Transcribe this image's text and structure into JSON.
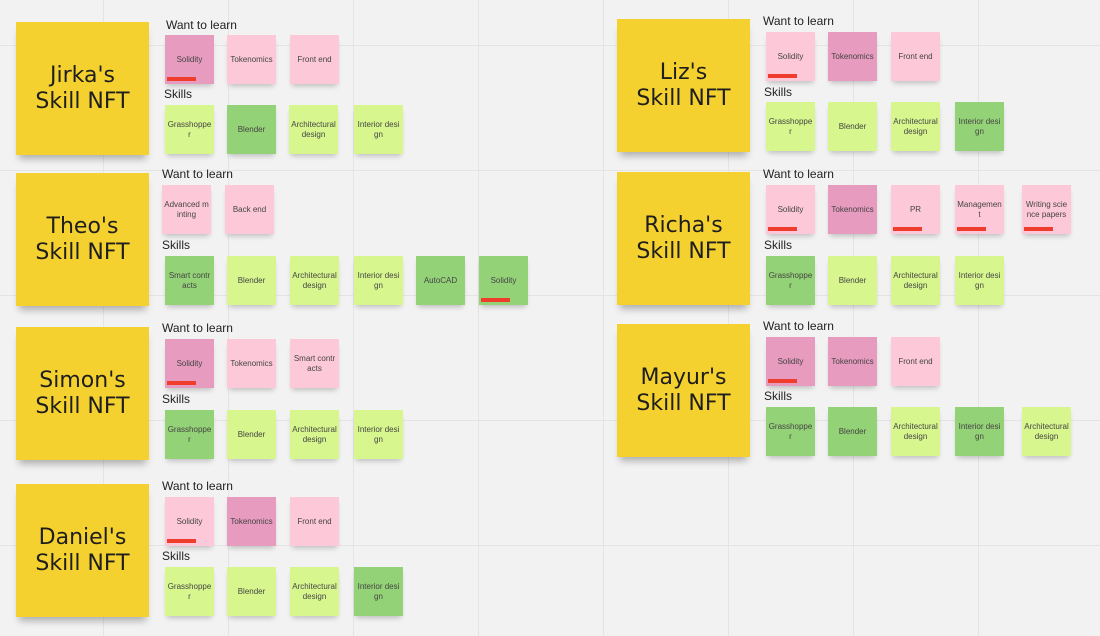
{
  "colors": {
    "title_note": "#f5d12f",
    "light_pink": "#fdc9d9",
    "dark_pink": "#e79bbf",
    "light_green": "#d7f78e",
    "dark_green": "#94d277",
    "marker": "#ee3d2c"
  },
  "labels": {
    "want": "Want to learn",
    "skills": "Skills"
  },
  "cards": [
    {
      "name": "Jirka's\nSkill NFT",
      "want": [
        {
          "text": "Solidity",
          "color": "dark-pink",
          "marked": true
        },
        {
          "text": "Tokenomics",
          "color": "light-pink",
          "marked": false
        },
        {
          "text": "Front end",
          "color": "light-pink",
          "marked": false
        }
      ],
      "skills": [
        {
          "text": "Grasshopper",
          "color": "light-green",
          "marked": false
        },
        {
          "text": "Blender",
          "color": "dark-green",
          "marked": false
        },
        {
          "text": "Architectural design",
          "color": "light-green",
          "marked": false
        },
        {
          "text": "Interior design",
          "color": "light-green",
          "marked": false
        }
      ]
    },
    {
      "name": "Theo's\nSkill NFT",
      "want": [
        {
          "text": "Advanced minting",
          "color": "light-pink",
          "marked": false
        },
        {
          "text": "Back end",
          "color": "light-pink",
          "marked": false
        }
      ],
      "skills": [
        {
          "text": "Smart contracts",
          "color": "dark-green",
          "marked": false
        },
        {
          "text": "Blender",
          "color": "light-green",
          "marked": false
        },
        {
          "text": "Architectural design",
          "color": "light-green",
          "marked": false
        },
        {
          "text": "Interior design",
          "color": "light-green",
          "marked": false
        },
        {
          "text": "AutoCAD",
          "color": "dark-green",
          "marked": false
        },
        {
          "text": "Solidity",
          "color": "dark-green",
          "marked": true
        }
      ]
    },
    {
      "name": "Simon's\nSkill NFT",
      "want": [
        {
          "text": "Solidity",
          "color": "dark-pink",
          "marked": true
        },
        {
          "text": "Tokenomics",
          "color": "light-pink",
          "marked": false
        },
        {
          "text": "Smart contracts",
          "color": "light-pink",
          "marked": false
        }
      ],
      "skills": [
        {
          "text": "Grasshopper",
          "color": "dark-green",
          "marked": false
        },
        {
          "text": "Blender",
          "color": "light-green",
          "marked": false
        },
        {
          "text": "Architectural design",
          "color": "light-green",
          "marked": false
        },
        {
          "text": "Interior design",
          "color": "light-green",
          "marked": false
        }
      ]
    },
    {
      "name": "Daniel's\nSkill NFT",
      "want": [
        {
          "text": "Solidity",
          "color": "light-pink",
          "marked": true
        },
        {
          "text": "Tokenomics",
          "color": "dark-pink",
          "marked": false
        },
        {
          "text": "Front end",
          "color": "light-pink",
          "marked": false
        }
      ],
      "skills": [
        {
          "text": "Grasshopper",
          "color": "light-green",
          "marked": false
        },
        {
          "text": "Blender",
          "color": "light-green",
          "marked": false
        },
        {
          "text": "Architectural design",
          "color": "light-green",
          "marked": false
        },
        {
          "text": "Interior design",
          "color": "dark-green",
          "marked": false
        }
      ]
    },
    {
      "name": "Liz's\nSkill NFT",
      "want": [
        {
          "text": "Solidity",
          "color": "light-pink",
          "marked": true
        },
        {
          "text": "Tokenomics",
          "color": "dark-pink",
          "marked": false
        },
        {
          "text": "Front end",
          "color": "light-pink",
          "marked": false
        }
      ],
      "skills": [
        {
          "text": "Grasshopper",
          "color": "light-green",
          "marked": false
        },
        {
          "text": "Blender",
          "color": "light-green",
          "marked": false
        },
        {
          "text": "Architectural design",
          "color": "light-green",
          "marked": false
        },
        {
          "text": "Interior design",
          "color": "dark-green",
          "marked": false
        }
      ]
    },
    {
      "name": "Richa's\nSkill NFT",
      "want": [
        {
          "text": "Solidity",
          "color": "light-pink",
          "marked": true
        },
        {
          "text": "Tokenomics",
          "color": "dark-pink",
          "marked": false
        },
        {
          "text": "PR",
          "color": "light-pink",
          "marked": true
        },
        {
          "text": "Management",
          "color": "light-pink",
          "marked": true
        },
        {
          "text": "Writing science papers",
          "color": "light-pink",
          "marked": true
        }
      ],
      "skills": [
        {
          "text": "Grasshopper",
          "color": "dark-green",
          "marked": false
        },
        {
          "text": "Blender",
          "color": "light-green",
          "marked": false
        },
        {
          "text": "Architectural design",
          "color": "light-green",
          "marked": false
        },
        {
          "text": "Interior design",
          "color": "light-green",
          "marked": false
        }
      ]
    },
    {
      "name": "Mayur's\nSkill NFT",
      "want": [
        {
          "text": "Solidity",
          "color": "dark-pink",
          "marked": true
        },
        {
          "text": "Tokenomics",
          "color": "dark-pink",
          "marked": false
        },
        {
          "text": "Front end",
          "color": "light-pink",
          "marked": false
        }
      ],
      "skills": [
        {
          "text": "Grasshopper",
          "color": "dark-green",
          "marked": false
        },
        {
          "text": "Blender",
          "color": "dark-green",
          "marked": false
        },
        {
          "text": "Architectural design",
          "color": "light-green",
          "marked": false
        },
        {
          "text": "Interior design",
          "color": "dark-green",
          "marked": false
        },
        {
          "text": "Architectural design",
          "color": "light-green",
          "marked": false
        }
      ]
    }
  ]
}
